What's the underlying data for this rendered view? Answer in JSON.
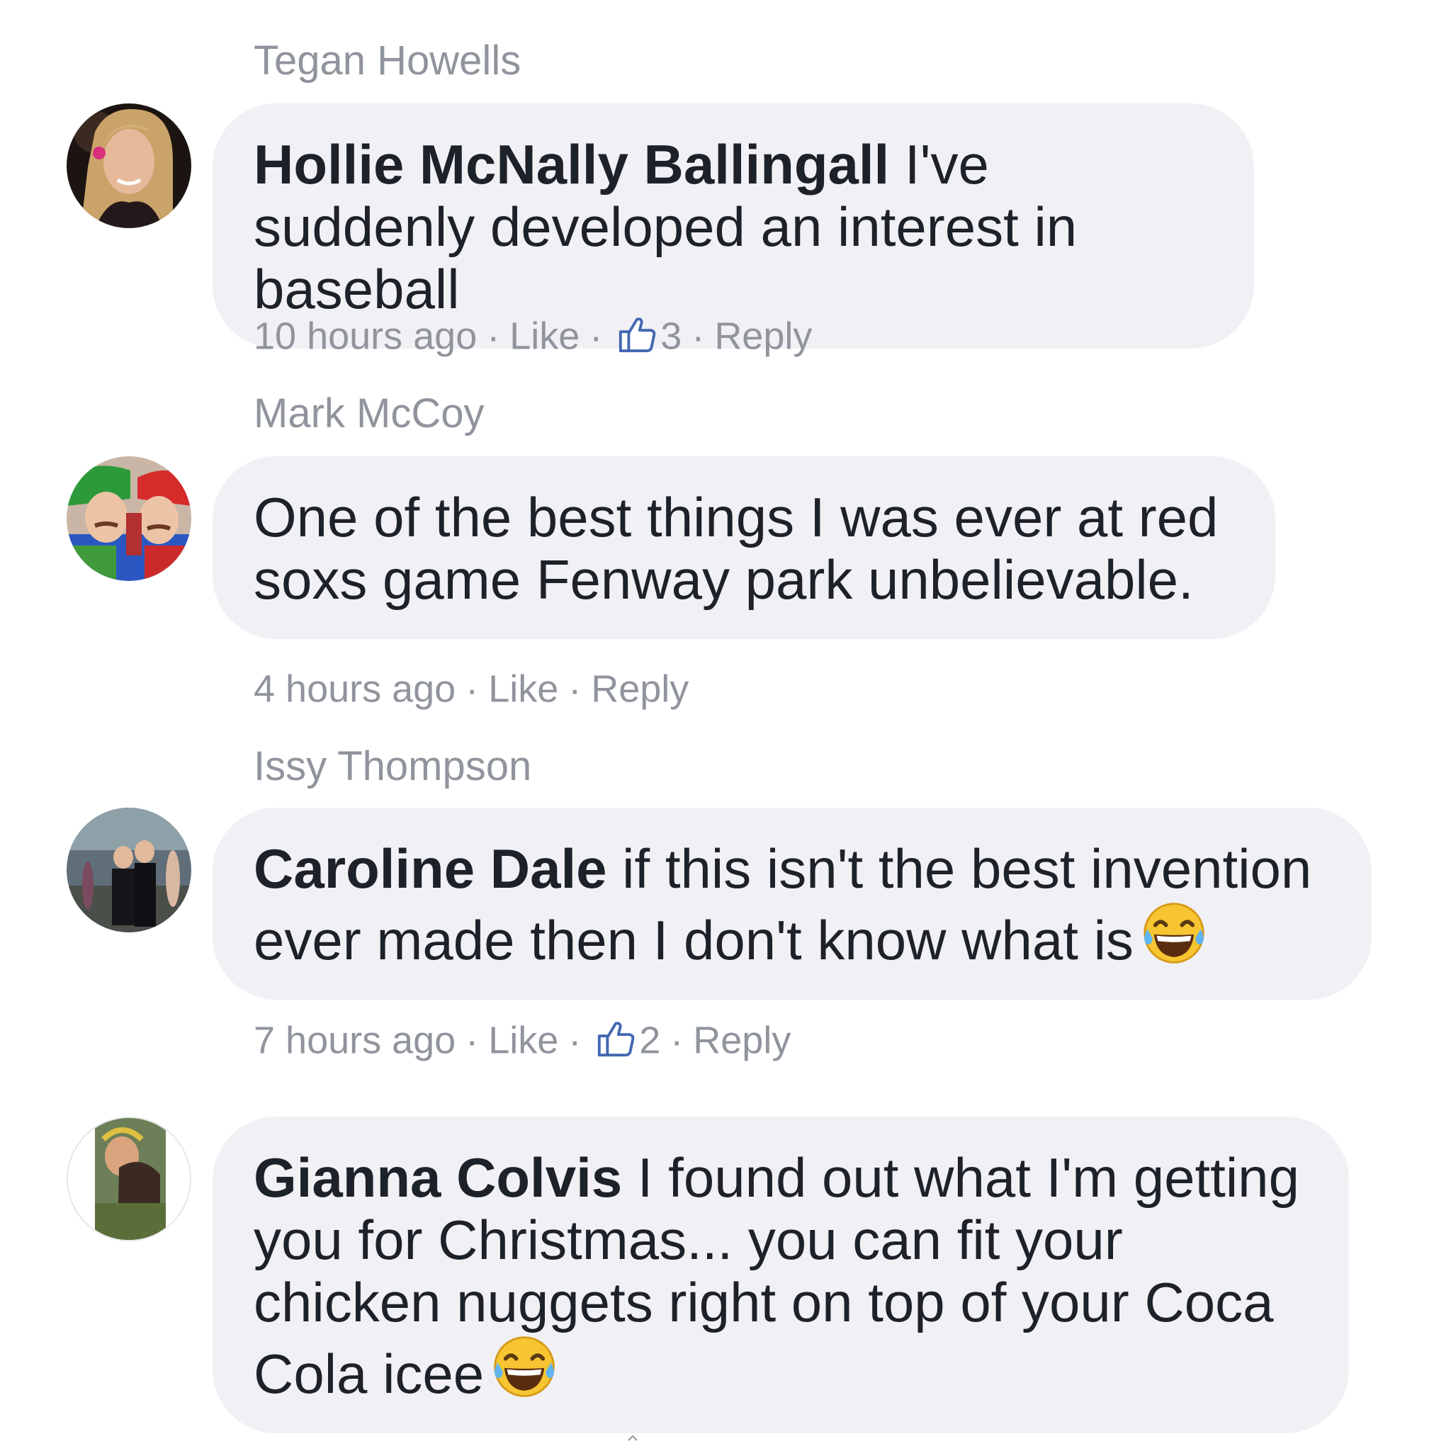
{
  "comments": [
    {
      "author_above": "Tegan Howells",
      "name": "Hollie McNally Ballingall",
      "text": " I've suddenly developed an interest in baseball",
      "time": "10 hours ago",
      "like": "Like",
      "like_count": "3",
      "reply": "Reply"
    },
    {
      "author_above": "Mark McCoy",
      "name": "",
      "text": "One of the best things I was ever at red soxs game Fenway park unbelievable.",
      "time": "4 hours ago",
      "like": "Like",
      "reply": "Reply"
    },
    {
      "author_above": "Issy Thompson",
      "name": "Caroline Dale",
      "text": " if this isn't the best invention ever made then I don't know what is",
      "emoji": "tears-of-joy-emoji",
      "time": "7 hours ago",
      "like": "Like",
      "like_count": "2",
      "reply": "Reply"
    },
    {
      "name": "Gianna Colvis",
      "text": " I found out what I'm getting you for Christmas... you can fit your chicken nuggets right on top of your Coca Cola icee",
      "emoji": "tears-of-joy-emoji"
    }
  ],
  "separator": "·",
  "colors": {
    "bubble": "#f1f0f4",
    "text": "#1d2129",
    "meta": "#90949c",
    "like_icon": "#4267b2"
  }
}
